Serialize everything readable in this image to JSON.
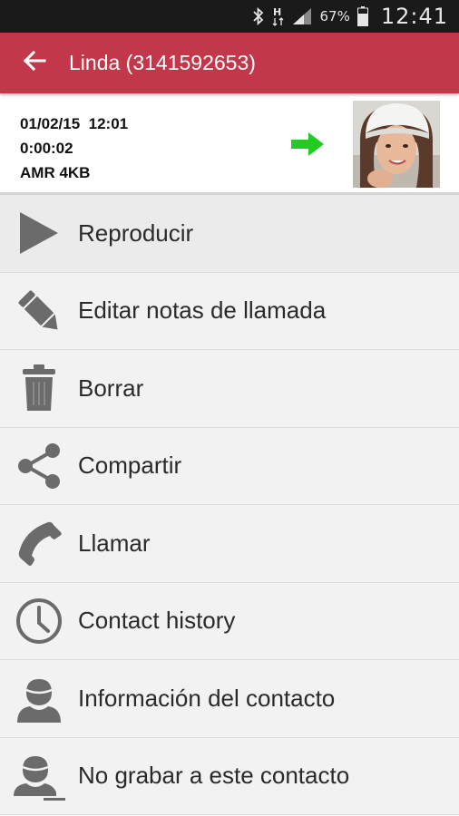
{
  "status_bar": {
    "battery_percent": "67%",
    "time": "12:41",
    "icons": [
      "bluetooth-icon",
      "data-transfer-icon",
      "signal-icon",
      "battery-icon"
    ]
  },
  "app_bar": {
    "back_icon": "arrow-left-icon",
    "title": "Linda (3141592653)",
    "color": "#c2384a"
  },
  "recording": {
    "datetime": "01/02/15  12:01",
    "duration": "0:00:02",
    "format": "AMR 4KB",
    "direction_icon": "outgoing-arrow-icon",
    "direction_color": "#22cc22",
    "contact_photo": "contact-photo"
  },
  "menu": {
    "items": [
      {
        "label": "Reproducir",
        "icon": "play-icon"
      },
      {
        "label": "Editar notas de llamada",
        "icon": "pencil-icon"
      },
      {
        "label": "Borrar",
        "icon": "trash-icon"
      },
      {
        "label": "Compartir",
        "icon": "share-icon"
      },
      {
        "label": "Llamar",
        "icon": "phone-icon"
      },
      {
        "label": "Contact history",
        "icon": "clock-icon"
      },
      {
        "label": "Información del contacto",
        "icon": "contact-person-icon"
      },
      {
        "label": "No grabar a este contacto",
        "icon": "contact-ignore-icon"
      }
    ]
  }
}
